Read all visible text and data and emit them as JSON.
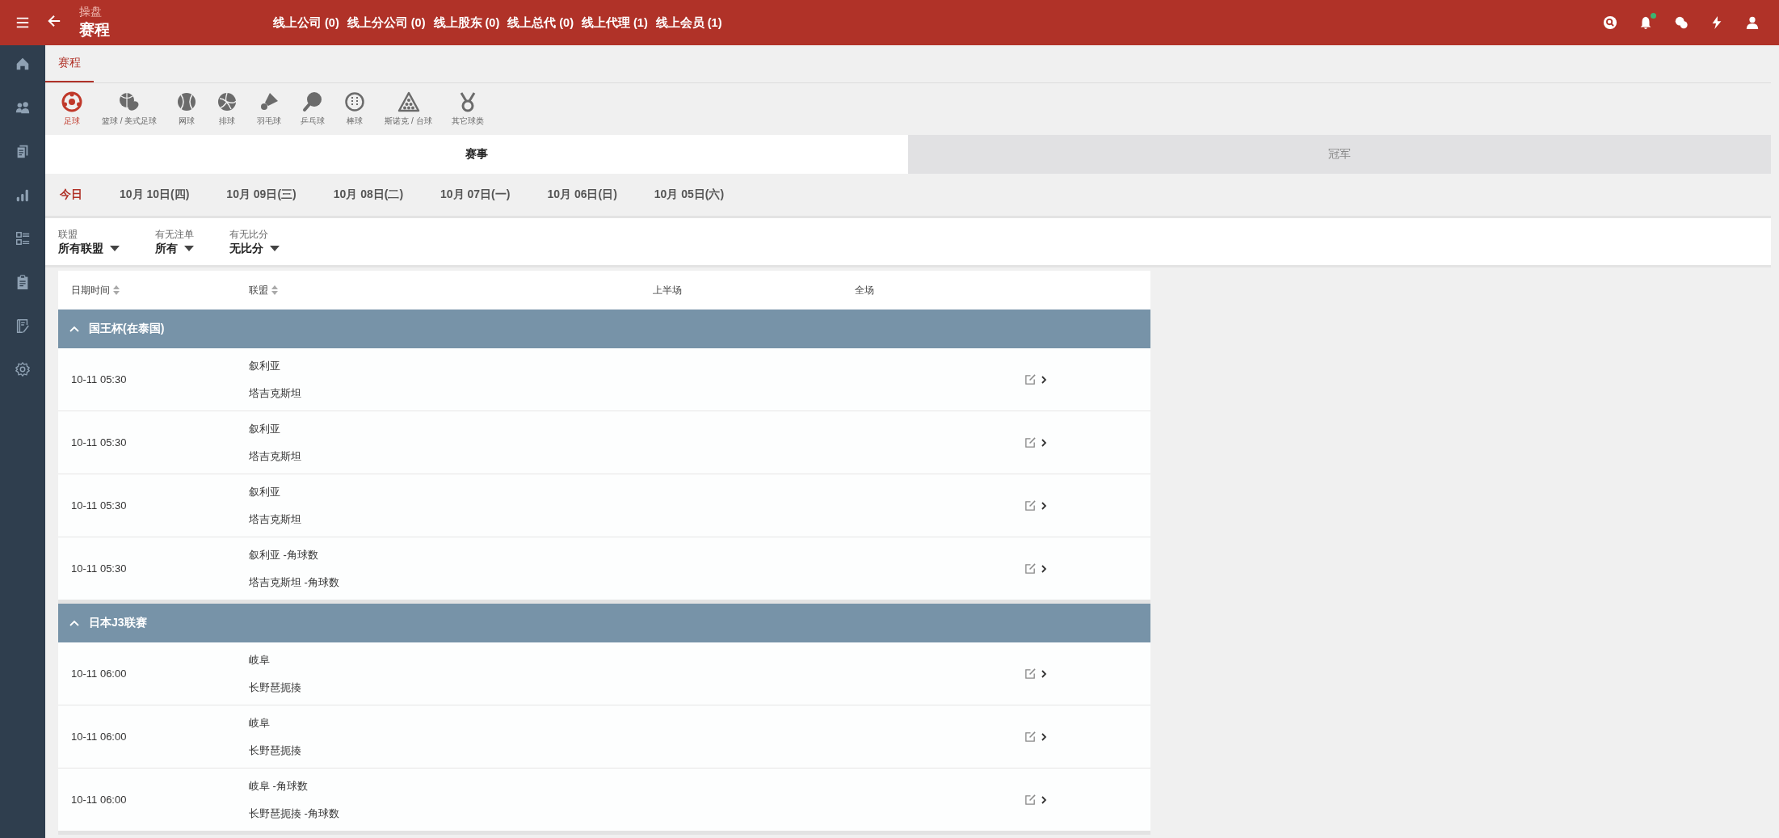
{
  "top_bar": {
    "subtitle": "操盘",
    "title": "赛程",
    "links": [
      "线上公司 (0)",
      "线上分公司 (0)",
      "线上股东 (0)",
      "线上总代 (0)",
      "线上代理 (1)",
      "线上会员 (1)"
    ],
    "notification_dot": {
      "color": "#3cb371"
    }
  },
  "page_tabs": [
    {
      "label": "赛程",
      "selected": true
    }
  ],
  "sports": [
    {
      "label": "足球",
      "kind": "soccer",
      "selected": true
    },
    {
      "label": "篮球 / 美式足球",
      "kind": "basketball",
      "selected": false
    },
    {
      "label": "网球",
      "kind": "tennis",
      "selected": false
    },
    {
      "label": "排球",
      "kind": "volleyball",
      "selected": false
    },
    {
      "label": "羽毛球",
      "kind": "badminton",
      "selected": false
    },
    {
      "label": "乒乓球",
      "kind": "pingpong",
      "selected": false
    },
    {
      "label": "棒球",
      "kind": "baseball",
      "selected": false
    },
    {
      "label": "斯诺克 / 台球",
      "kind": "snooker",
      "selected": false
    },
    {
      "label": "其它球类",
      "kind": "other",
      "selected": false
    }
  ],
  "segments": [
    {
      "label": "赛事",
      "selected": true
    },
    {
      "label": "冠军",
      "selected": false
    }
  ],
  "dates": [
    {
      "label": "今日",
      "selected": true
    },
    {
      "label": "10月 10日(四)",
      "selected": false
    },
    {
      "label": "10月 09日(三)",
      "selected": false
    },
    {
      "label": "10月 08日(二)",
      "selected": false
    },
    {
      "label": "10月 07日(一)",
      "selected": false
    },
    {
      "label": "10月 06日(日)",
      "selected": false
    },
    {
      "label": "10月 05日(六)",
      "selected": false
    }
  ],
  "filters": [
    {
      "label": "联盟",
      "value": "所有联盟"
    },
    {
      "label": "有无注单",
      "value": "所有"
    },
    {
      "label": "有无比分",
      "value": "无比分"
    }
  ],
  "table": {
    "columns": [
      {
        "label": "日期时间",
        "sortable": true
      },
      {
        "label": "联盟",
        "sortable": true
      },
      {
        "label": "上半场",
        "sortable": false
      },
      {
        "label": "全场",
        "sortable": false
      }
    ],
    "groups": [
      {
        "name": "国王杯(在泰国)",
        "expanded": true,
        "rows": [
          {
            "time": "10-11 05:30",
            "home": "叙利亚",
            "away": "塔吉克斯坦"
          },
          {
            "time": "10-11 05:30",
            "home": "叙利亚",
            "away": "塔吉克斯坦"
          },
          {
            "time": "10-11 05:30",
            "home": "叙利亚",
            "away": "塔吉克斯坦"
          },
          {
            "time": "10-11 05:30",
            "home": "叙利亚 -角球数",
            "away": "塔吉克斯坦 -角球数"
          }
        ]
      },
      {
        "name": "日本J3联赛",
        "expanded": true,
        "rows": [
          {
            "time": "10-11 06:00",
            "home": "岐阜",
            "away": "长野琶扼揍"
          },
          {
            "time": "10-11 06:00",
            "home": "岐阜",
            "away": "长野琶扼揍"
          },
          {
            "time": "10-11 06:00",
            "home": "岐阜 -角球数",
            "away": "长野琶扼揍 -角球数"
          }
        ]
      }
    ]
  }
}
